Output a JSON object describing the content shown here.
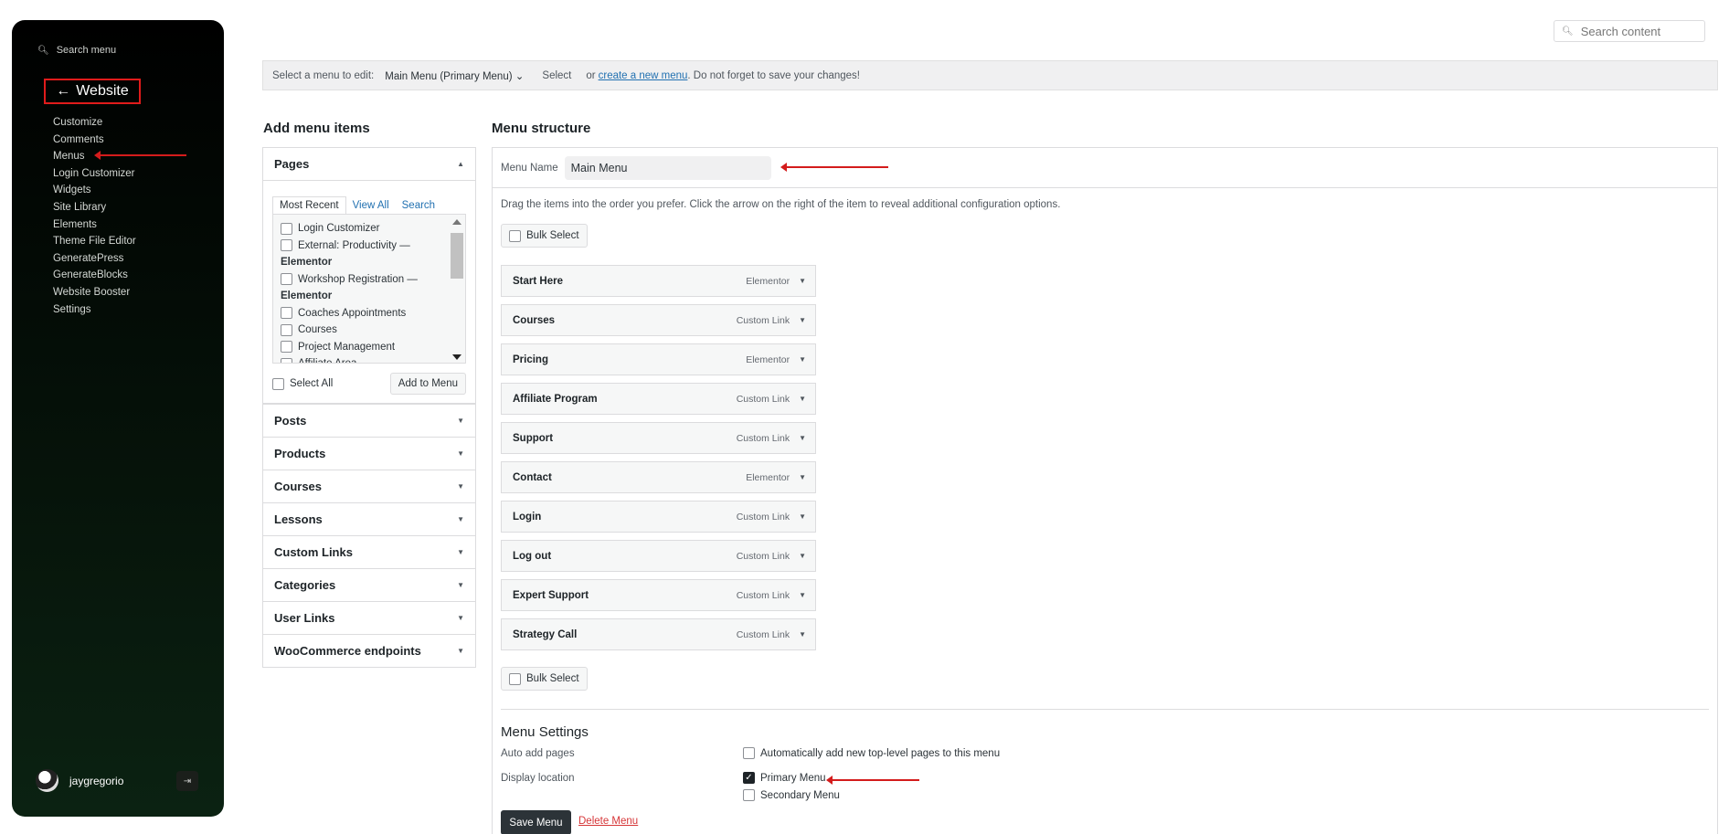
{
  "sidebar": {
    "search_label": "Search menu",
    "back_label": "Website",
    "nav": [
      "Customize",
      "Comments",
      "Menus",
      "Login Customizer",
      "Widgets",
      "Site Library",
      "Elements",
      "Theme File Editor",
      "GeneratePress",
      "GenerateBlocks",
      "Website Booster",
      "Settings"
    ],
    "user": "jaygregorio"
  },
  "top_search": {
    "placeholder": "Search content"
  },
  "manage": {
    "prompt": "Select a menu to edit:",
    "selected_menu": "Main Menu (Primary Menu)",
    "select_button": "Select",
    "or_text": "or",
    "create_link": "create a new menu",
    "tail_text": ". Do not forget to save your changes!"
  },
  "add_items": {
    "title": "Add menu items",
    "pages_title": "Pages",
    "tabs": [
      "Most Recent",
      "View All",
      "Search"
    ],
    "page_list": [
      {
        "label": "Login Customizer",
        "bold": false
      },
      {
        "label": "External: Productivity —",
        "bold": false
      },
      {
        "label": "Elementor",
        "bold": true
      },
      {
        "label": "Workshop Registration —",
        "bold": false
      },
      {
        "label": "Elementor",
        "bold": true
      },
      {
        "label": "Coaches Appointments",
        "bold": false
      },
      {
        "label": "Courses",
        "bold": false
      },
      {
        "label": "Project Management",
        "bold": false
      },
      {
        "label": "Affiliate Area",
        "bold": false
      }
    ],
    "select_all": "Select All",
    "add_button": "Add to Menu",
    "sections": [
      "Posts",
      "Products",
      "Courses",
      "Lessons",
      "Custom Links",
      "Categories",
      "User Links",
      "WooCommerce endpoints"
    ]
  },
  "structure": {
    "title": "Menu structure",
    "name_label": "Menu Name",
    "name_value": "Main Menu",
    "instructions": "Drag the items into the order you prefer. Click the arrow on the right of the item to reveal additional configuration options.",
    "bulk_select": "Bulk Select",
    "items": [
      {
        "title": "Start Here",
        "type": "Elementor"
      },
      {
        "title": "Courses",
        "type": "Custom Link"
      },
      {
        "title": "Pricing",
        "type": "Elementor"
      },
      {
        "title": "Affiliate Program",
        "type": "Custom Link"
      },
      {
        "title": "Support",
        "type": "Custom Link"
      },
      {
        "title": "Contact",
        "type": "Elementor"
      },
      {
        "title": "Login",
        "type": "Custom Link"
      },
      {
        "title": "Log out",
        "type": "Custom Link"
      },
      {
        "title": "Expert Support",
        "type": "Custom Link"
      },
      {
        "title": "Strategy Call",
        "type": "Custom Link"
      }
    ],
    "settings": {
      "title": "Menu Settings",
      "auto_add_label": "Auto add pages",
      "auto_add_option": "Automatically add new top-level pages to this menu",
      "auto_add_checked": false,
      "display_label": "Display location",
      "locations": [
        {
          "label": "Primary Menu",
          "checked": true
        },
        {
          "label": "Secondary Menu",
          "checked": false
        }
      ]
    },
    "save_button": "Save Menu",
    "delete_link": "Delete Menu"
  },
  "colors": {
    "annotation_red": "#d41c1c",
    "link_blue": "#2271b1",
    "delete_red": "#d63638"
  }
}
